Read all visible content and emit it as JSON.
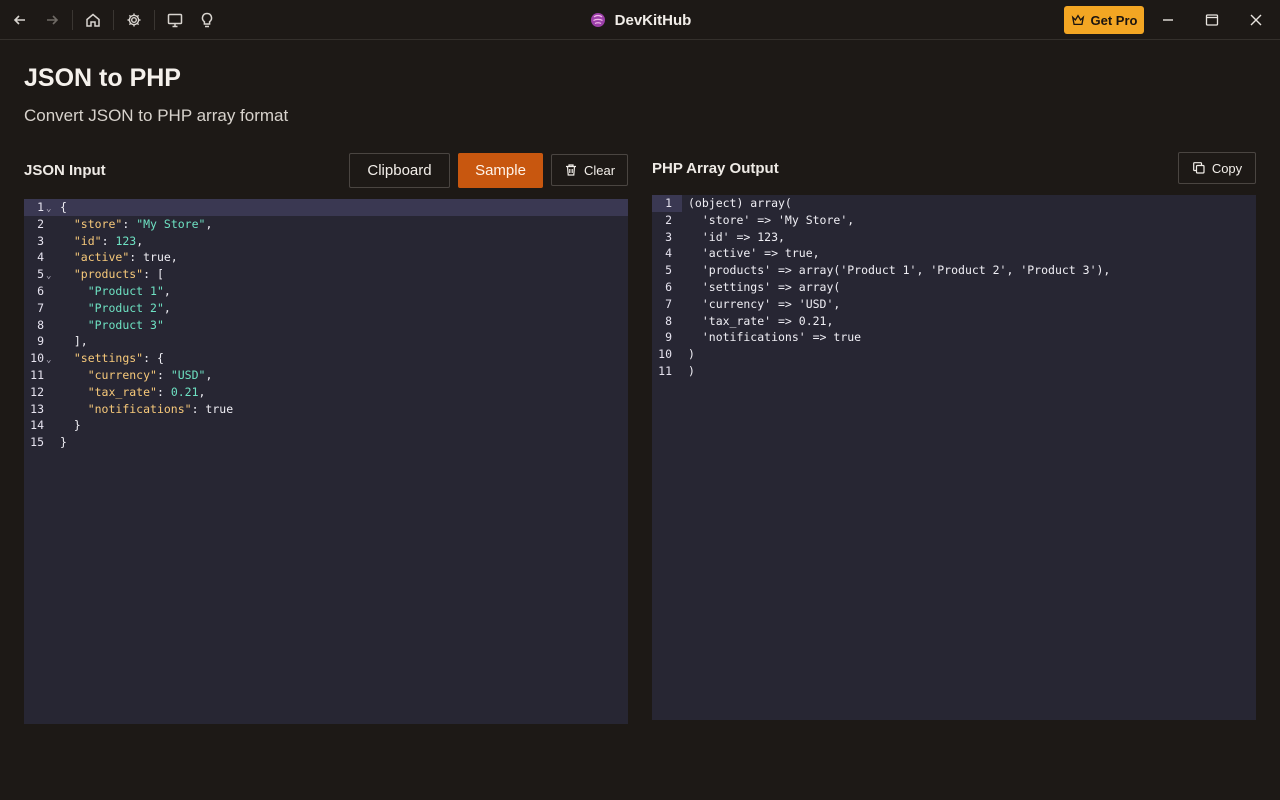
{
  "app": {
    "title": "DevKitHub",
    "get_pro_label": "Get Pro"
  },
  "page": {
    "title": "JSON to PHP",
    "subtitle": "Convert JSON to PHP array format"
  },
  "input_panel": {
    "label": "JSON Input",
    "clipboard_label": "Clipboard",
    "sample_label": "Sample",
    "clear_label": "Clear",
    "lines": [
      "{",
      "  \"store\": \"My Store\",",
      "  \"id\": 123,",
      "  \"active\": true,",
      "  \"products\": [",
      "    \"Product 1\",",
      "    \"Product 2\",",
      "    \"Product 3\"",
      "  ],",
      "  \"settings\": {",
      "    \"currency\": \"USD\",",
      "    \"tax_rate\": 0.21,",
      "    \"notifications\": true",
      "  }",
      "}"
    ],
    "fold_lines": [
      1,
      5,
      10
    ]
  },
  "output_panel": {
    "label": "PHP Array Output",
    "copy_label": "Copy",
    "lines": [
      "(object) array(",
      "  'store' => 'My Store',",
      "  'id' => 123,",
      "  'active' => true,",
      "  'products' => array('Product 1', 'Product 2', 'Product 3'),",
      "  'settings' => array(",
      "  'currency' => 'USD',",
      "  'tax_rate' => 0.21,",
      "  'notifications' => true",
      ")",
      ")"
    ]
  },
  "colors": {
    "accent": "#c8570f",
    "pro": "#f3a623",
    "editor_bg": "#272633",
    "json_key": "#f7c97a",
    "json_value": "#6ee2c3"
  },
  "icons": {
    "back": "arrow-left-icon",
    "forward": "arrow-right-icon",
    "home": "home-icon",
    "settings": "gear-icon",
    "display": "monitor-icon",
    "tips": "lightbulb-icon",
    "pro": "crown-icon",
    "clear": "trash-icon",
    "copy": "copy-icon"
  }
}
